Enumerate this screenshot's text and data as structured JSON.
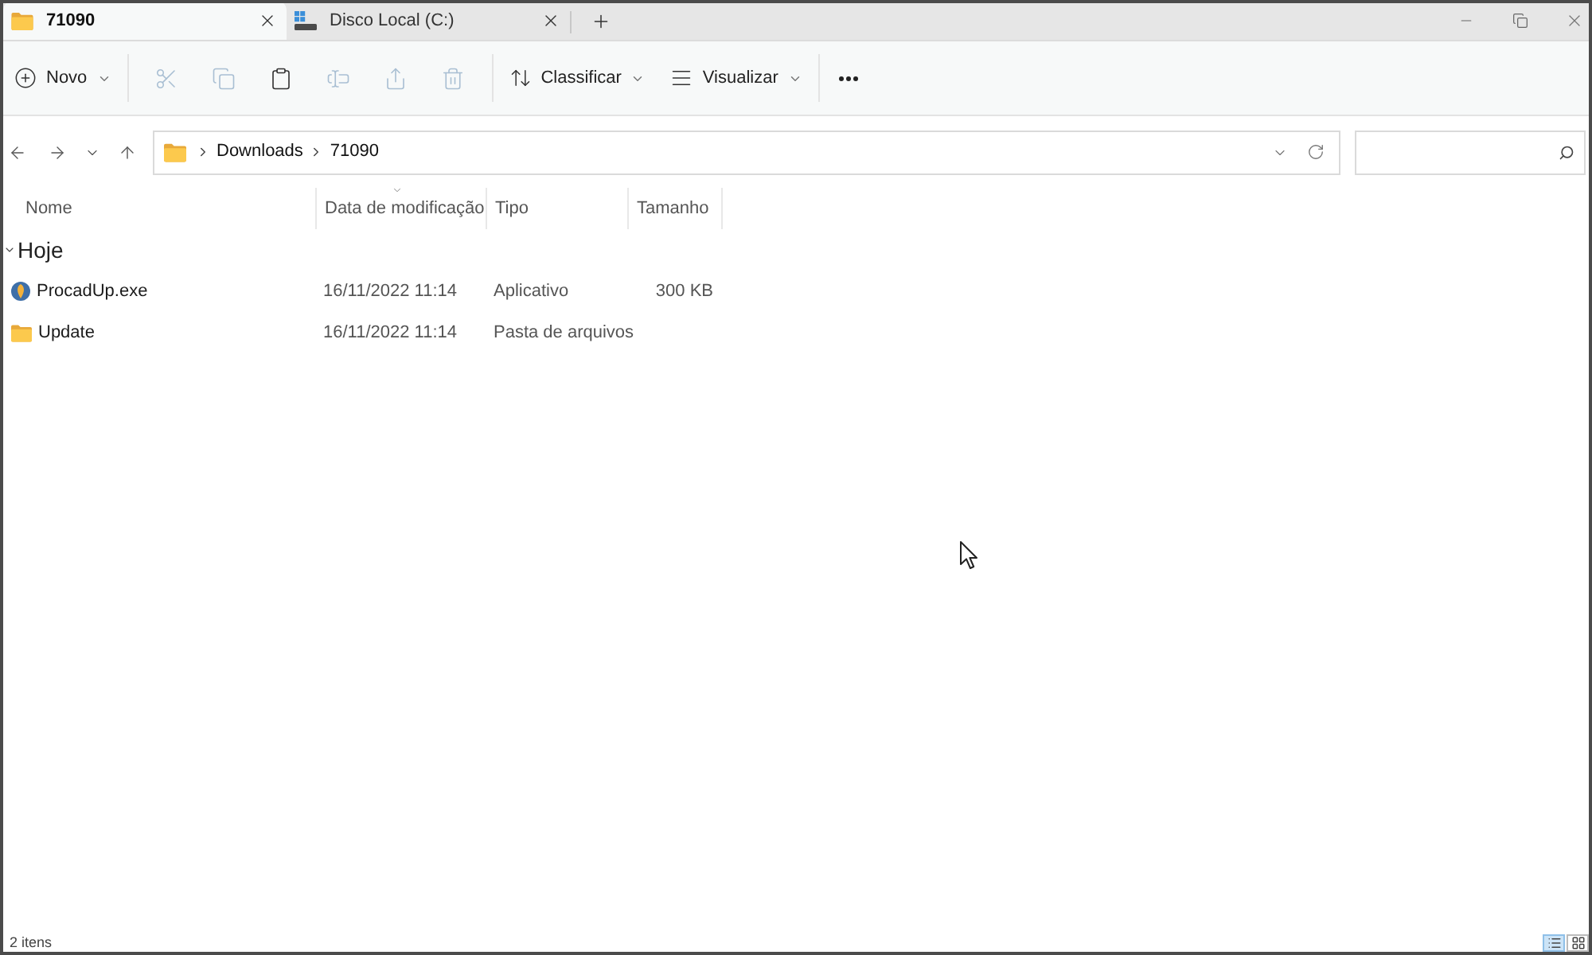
{
  "tabs": [
    {
      "kind": "folder",
      "label": "71090",
      "selected": true
    },
    {
      "kind": "drive",
      "label": "Disco Local (C:)",
      "selected": false
    }
  ],
  "toolbar": {
    "new_label": "Novo",
    "actions": [
      {
        "kind": "cut",
        "disabled": true
      },
      {
        "kind": "copy",
        "disabled": true
      },
      {
        "kind": "paste",
        "disabled": false
      },
      {
        "kind": "rename",
        "disabled": true
      },
      {
        "kind": "share",
        "disabled": true
      },
      {
        "kind": "delete",
        "disabled": true
      }
    ],
    "sort_label": "Classificar",
    "view_label": "Visualizar"
  },
  "address": {
    "path": [
      "Downloads",
      "71090"
    ]
  },
  "columns": [
    {
      "label": "Nome",
      "sorted": false
    },
    {
      "label": "Data de modificação",
      "sorted": true
    },
    {
      "label": "Tipo",
      "sorted": false
    },
    {
      "label": "Tamanho",
      "sorted": false
    }
  ],
  "groups": [
    {
      "label": "Hoje",
      "expanded": true,
      "rows": [
        {
          "kind": "app",
          "name": "ProcadUp.exe",
          "date": "16/11/2022 11:14",
          "type": "Aplicativo",
          "size": "300 KB"
        },
        {
          "kind": "folder",
          "name": "Update",
          "date": "16/11/2022 11:14",
          "type": "Pasta de arquivos"
        }
      ]
    }
  ],
  "status_bar": {
    "text": "2 itens",
    "views": [
      {
        "kind": "details",
        "selected": true
      },
      {
        "kind": "tiles",
        "selected": false
      }
    ]
  }
}
